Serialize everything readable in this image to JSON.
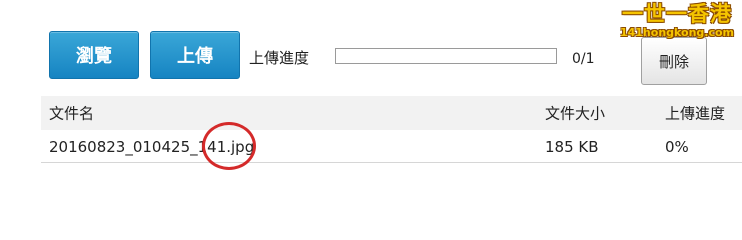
{
  "toolbar": {
    "browse_label": "瀏覽",
    "upload_label": "上傳",
    "progress_label": "上傳進度",
    "progress_fraction": 0,
    "progress_count": "0/1",
    "delete_label": "刪除"
  },
  "table": {
    "headers": [
      "文件名",
      "文件大小",
      "上傳進度"
    ],
    "rows": [
      {
        "name": "20160823_010425_141.jpg",
        "size": "185 KB",
        "progress": "0%"
      }
    ]
  },
  "logo": {
    "main": "一世一香港",
    "sub": "141hongkong.com"
  },
  "colors": {
    "button_blue": "#1684c2",
    "annotation_red": "#d42a2a",
    "logo_yellow": "#f5c400"
  }
}
